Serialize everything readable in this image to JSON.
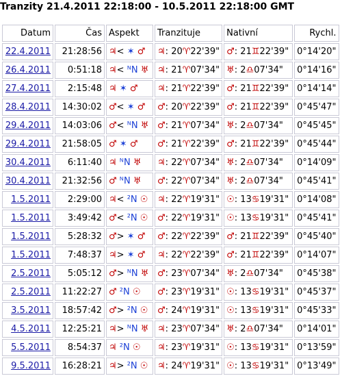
{
  "title": "Tranzity 21.4.2011 22:18:00 - 10.5.2011 22:18:00 GMT",
  "headers": {
    "date": "Datum",
    "time": "Čas",
    "aspect": "Aspekt",
    "transiting": "Tranzituje",
    "natal": "Nativní",
    "speed": "Rychl."
  },
  "colors": {
    "planet": "#c00000",
    "aspect_sign": "#1a3fd6",
    "link": "#1a1aa6",
    "border": "#c9c9d6"
  },
  "rows": [
    {
      "date": "22.4.2011",
      "time": "21:28:56",
      "aspect": "♃< ✶ ♂",
      "transiting": "♃: 20♈22'39\"",
      "natal": "♂: 21♊22'39\"",
      "speed": "0°14'20\""
    },
    {
      "date": "26.4.2011",
      "time": "0:51:18",
      "aspect": "♃< ᴺN ♅",
      "transiting": "♃: 21♈07'34\"",
      "natal": "♅: 2♎07'34\"",
      "speed": "0°14'16\""
    },
    {
      "date": "27.4.2011",
      "time": "2:15:48",
      "aspect": "♃ ✶ ♂",
      "transiting": "♃: 21♈22'39\"",
      "natal": "♂: 21♊22'39\"",
      "speed": "0°14'14\""
    },
    {
      "date": "28.4.2011",
      "time": "14:30:02",
      "aspect": "♂< ✶ ♂",
      "transiting": "♂: 20♈22'39\"",
      "natal": "♂: 21♊22'39\"",
      "speed": "0°45'47\""
    },
    {
      "date": "29.4.2011",
      "time": "14:03:06",
      "aspect": "♂< ᴺN ♅",
      "transiting": "♂: 21♈07'34\"",
      "natal": "♅: 2♎07'34\"",
      "speed": "0°45'45\""
    },
    {
      "date": "29.4.2011",
      "time": "21:58:05",
      "aspect": "♂ ✶ ♂",
      "transiting": "♂: 21♈22'39\"",
      "natal": "♂: 21♊22'39\"",
      "speed": "0°45'44\""
    },
    {
      "date": "30.4.2011",
      "time": "6:11:40",
      "aspect": "♃ ᴺN ♅",
      "transiting": "♃: 22♈07'34\"",
      "natal": "♅: 2♎07'34\"",
      "speed": "0°14'09\""
    },
    {
      "date": "30.4.2011",
      "time": "21:32:56",
      "aspect": "♂ ᴺN ♅",
      "transiting": "♂: 22♈07'34\"",
      "natal": "♅: 2♎07'34\"",
      "speed": "0°45'41\""
    },
    {
      "date": "1.5.2011",
      "time": "2:29:00",
      "aspect": "♃< ²N ☉",
      "transiting": "♃: 22♈19'31\"",
      "natal": "☉: 13♋19'31\"",
      "speed": "0°14'08\""
    },
    {
      "date": "1.5.2011",
      "time": "3:49:42",
      "aspect": "♂< ²N ☉",
      "transiting": "♂: 22♈19'31\"",
      "natal": "☉: 13♋19'31\"",
      "speed": "0°45'41\""
    },
    {
      "date": "1.5.2011",
      "time": "5:28:32",
      "aspect": "♂> ✶ ♂",
      "transiting": "♂: 22♈22'39\"",
      "natal": "♂: 21♊22'39\"",
      "speed": "0°45'40\""
    },
    {
      "date": "1.5.2011",
      "time": "7:48:37",
      "aspect": "♃> ✶ ♂",
      "transiting": "♃: 22♈22'39\"",
      "natal": "♂: 21♊22'39\"",
      "speed": "0°14'07\""
    },
    {
      "date": "2.5.2011",
      "time": "5:05:12",
      "aspect": "♂> ᴺN ♅",
      "transiting": "♂: 23♈07'34\"",
      "natal": "♅: 2♎07'34\"",
      "speed": "0°45'38\""
    },
    {
      "date": "2.5.2011",
      "time": "11:22:27",
      "aspect": "♂ ²N ☉",
      "transiting": "♂: 23♈19'31\"",
      "natal": "☉: 13♋19'31\"",
      "speed": "0°45'37\""
    },
    {
      "date": "3.5.2011",
      "time": "18:57:42",
      "aspect": "♂> ²N ☉",
      "transiting": "♂: 24♈19'31\"",
      "natal": "☉: 13♋19'31\"",
      "speed": "0°45'33\""
    },
    {
      "date": "4.5.2011",
      "time": "12:25:21",
      "aspect": "♃> ᴺN ♅",
      "transiting": "♃: 23♈07'34\"",
      "natal": "♅: 2♎07'34\"",
      "speed": "0°14'01\""
    },
    {
      "date": "5.5.2011",
      "time": "8:54:37",
      "aspect": "♃ ²N ☉",
      "transiting": "♃: 23♈19'31\"",
      "natal": "☉: 13♋19'31\"",
      "speed": "0°13'59\""
    },
    {
      "date": "9.5.2011",
      "time": "16:28:21",
      "aspect": "♃> ²N ☉",
      "transiting": "♃: 24♈19'31\"",
      "natal": "☉: 13♋19'31\"",
      "speed": "0°13'49\""
    }
  ]
}
